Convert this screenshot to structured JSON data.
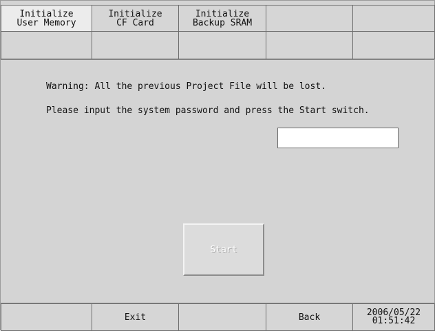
{
  "tabs": [
    {
      "label": "Initialize\nUser Memory"
    },
    {
      "label": "Initialize\nCF Card"
    },
    {
      "label": "Initialize\nBackup SRAM"
    },
    {
      "label": ""
    },
    {
      "label": ""
    }
  ],
  "messages": {
    "warning": "Warning: All the previous Project File will be lost.",
    "instruction": "Please input the system password and press the Start switch."
  },
  "password": {
    "value": "",
    "placeholder": ""
  },
  "start_button": {
    "label": "Start"
  },
  "bottom_bar": {
    "exit_label": "Exit",
    "back_label": "Back",
    "datetime": "2006/05/22\n01:51:42"
  }
}
